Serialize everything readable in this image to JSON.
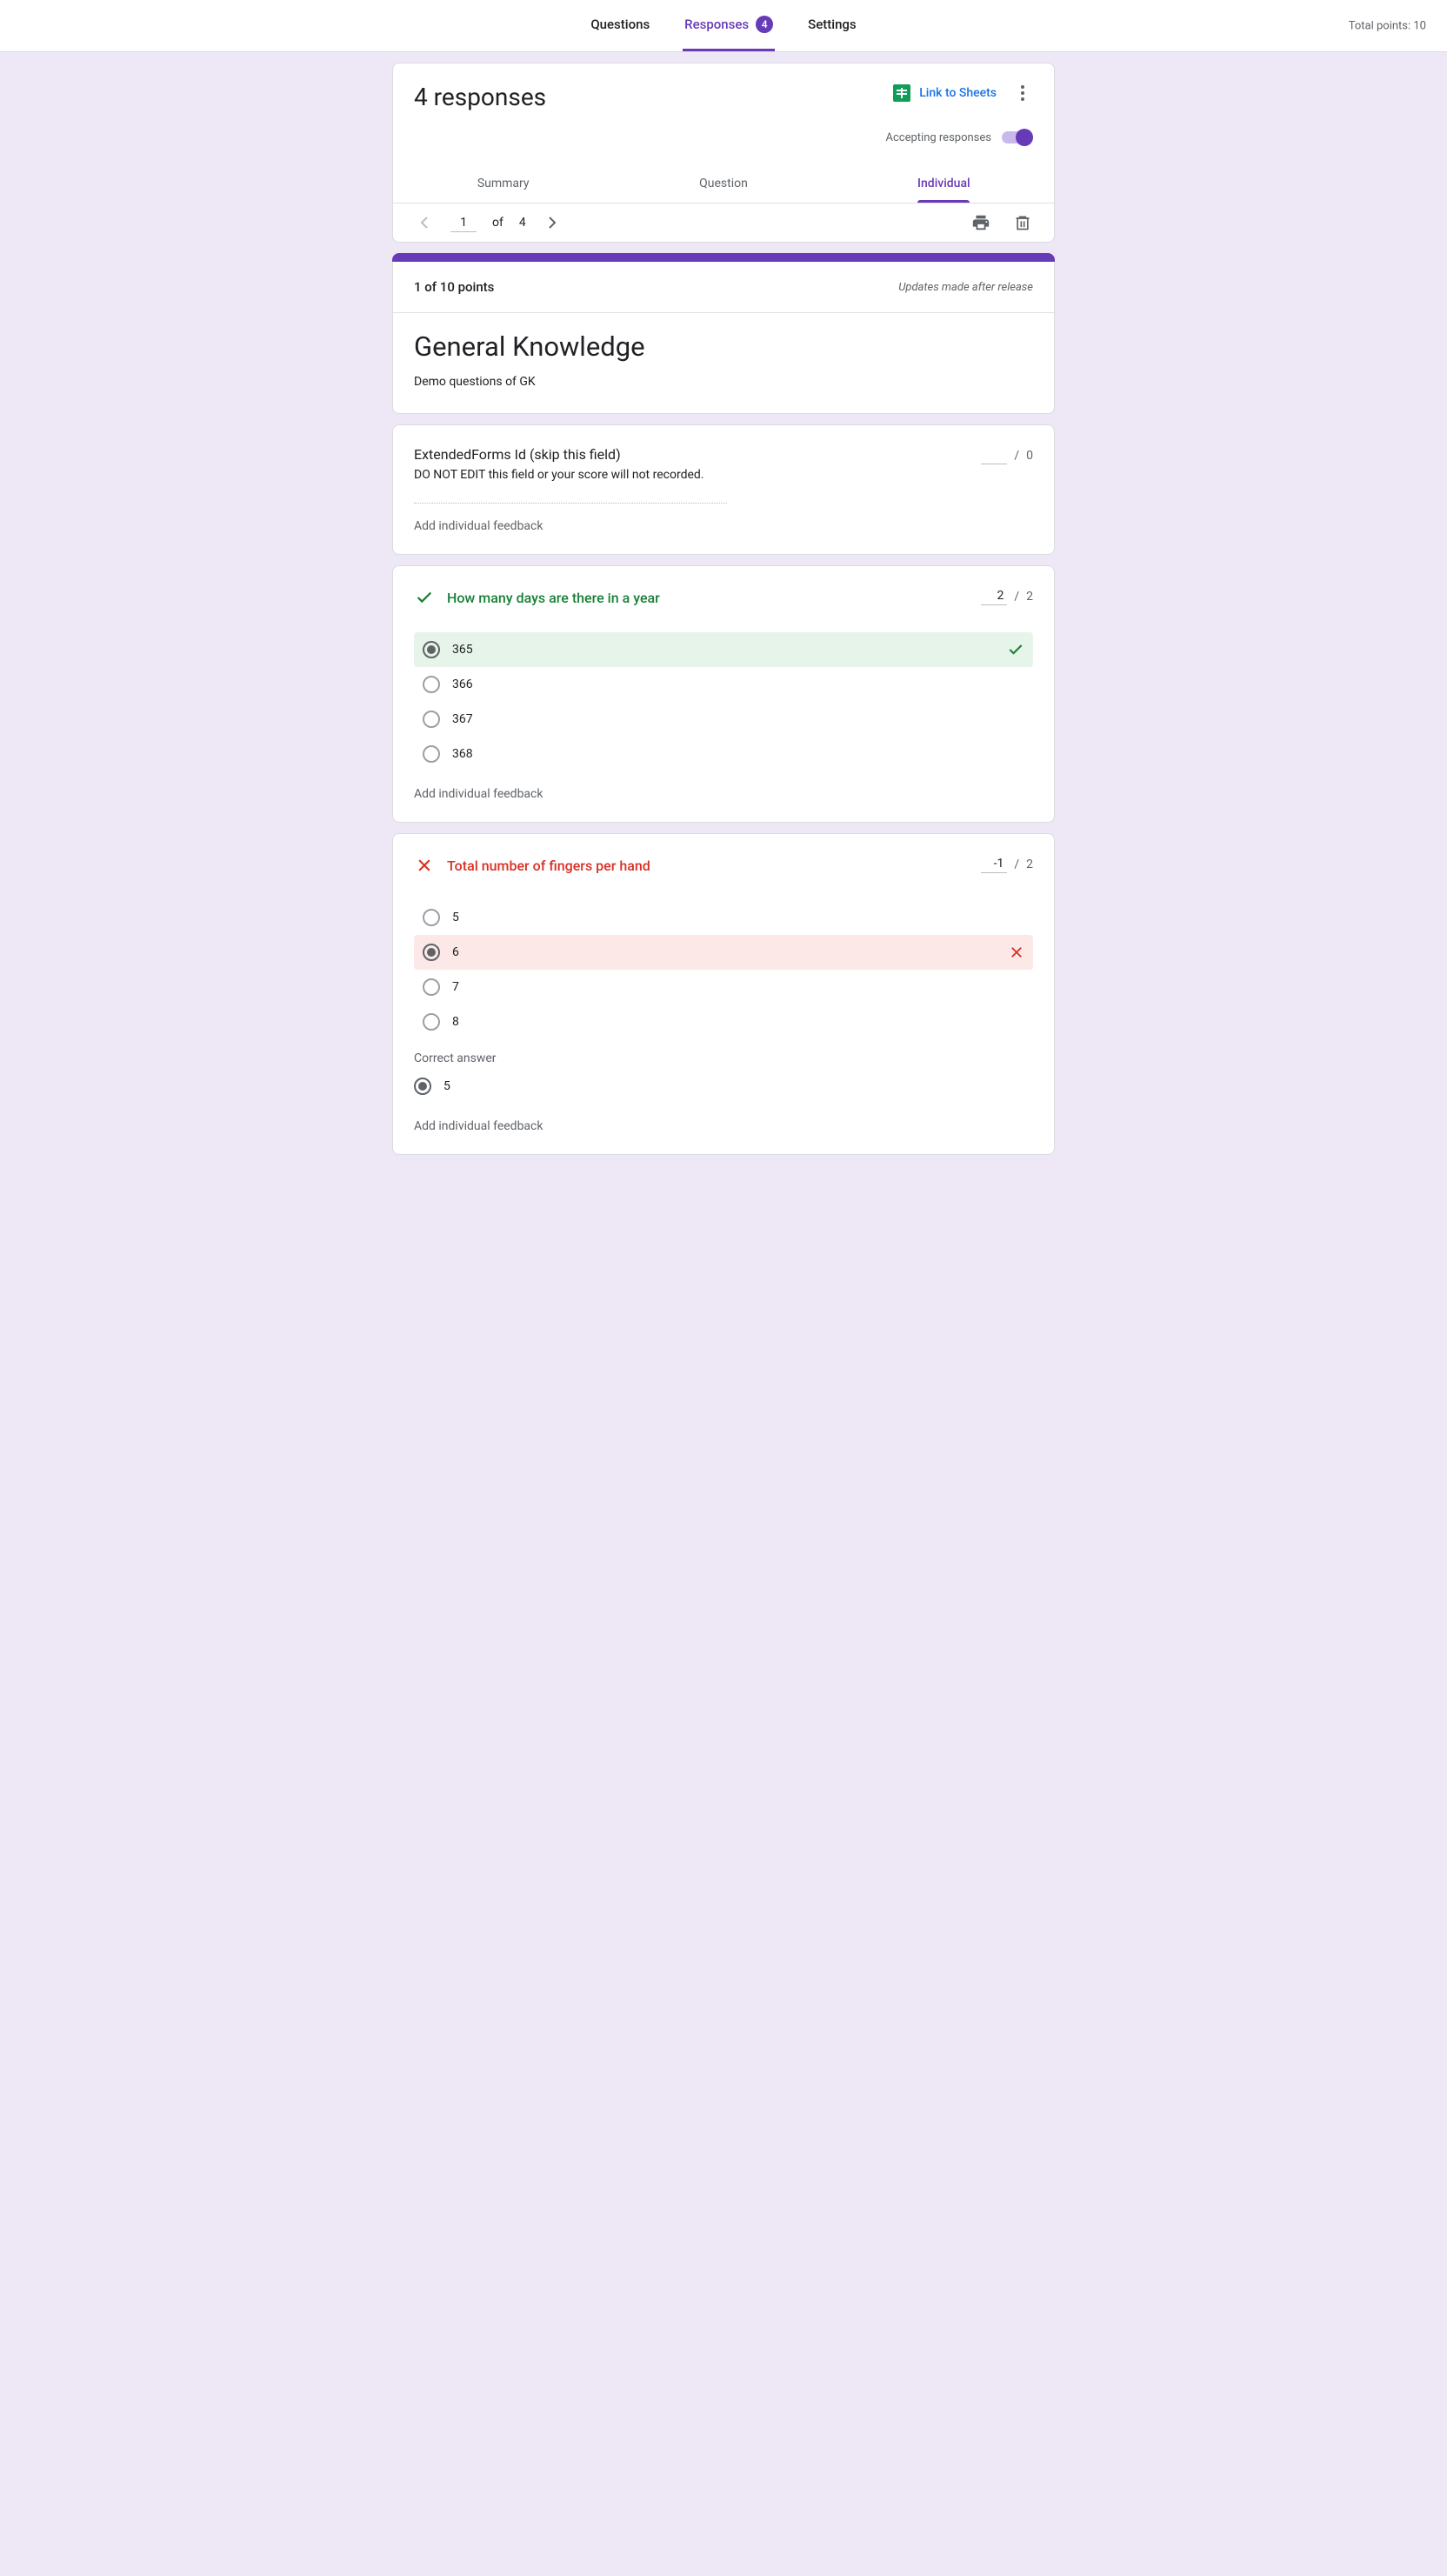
{
  "topbar": {
    "tabs": {
      "questions": "Questions",
      "responses": "Responses",
      "settings": "Settings",
      "badge": "4"
    },
    "total_points": "Total points: 10"
  },
  "responses": {
    "title": "4 responses",
    "link_sheets": "Link to Sheets",
    "accepting": "Accepting responses",
    "tabs": {
      "summary": "Summary",
      "question": "Question",
      "individual": "Individual"
    },
    "pager": {
      "current": "1",
      "of": "of",
      "total": "4"
    }
  },
  "score": {
    "label": "1 of 10 points",
    "note": "Updates made after release"
  },
  "form": {
    "title": "General Knowledge",
    "desc": "Demo questions of GK"
  },
  "q_ext": {
    "title": "ExtendedForms Id (skip this field)",
    "sub": "DO NOT EDIT this field or your score will not recorded.",
    "max": "0",
    "feedback": "Add individual feedback"
  },
  "q1": {
    "title": "How many days are there in a year",
    "score": "2",
    "max": "2",
    "opts": [
      "365",
      "366",
      "367",
      "368"
    ],
    "feedback": "Add individual feedback"
  },
  "q2": {
    "title": "Total number of fingers per hand",
    "score": "-1",
    "max": "2",
    "opts": [
      "5",
      "6",
      "7",
      "8"
    ],
    "correct_label": "Correct answer",
    "correct_val": "5",
    "feedback": "Add individual feedback"
  },
  "slash": "/"
}
